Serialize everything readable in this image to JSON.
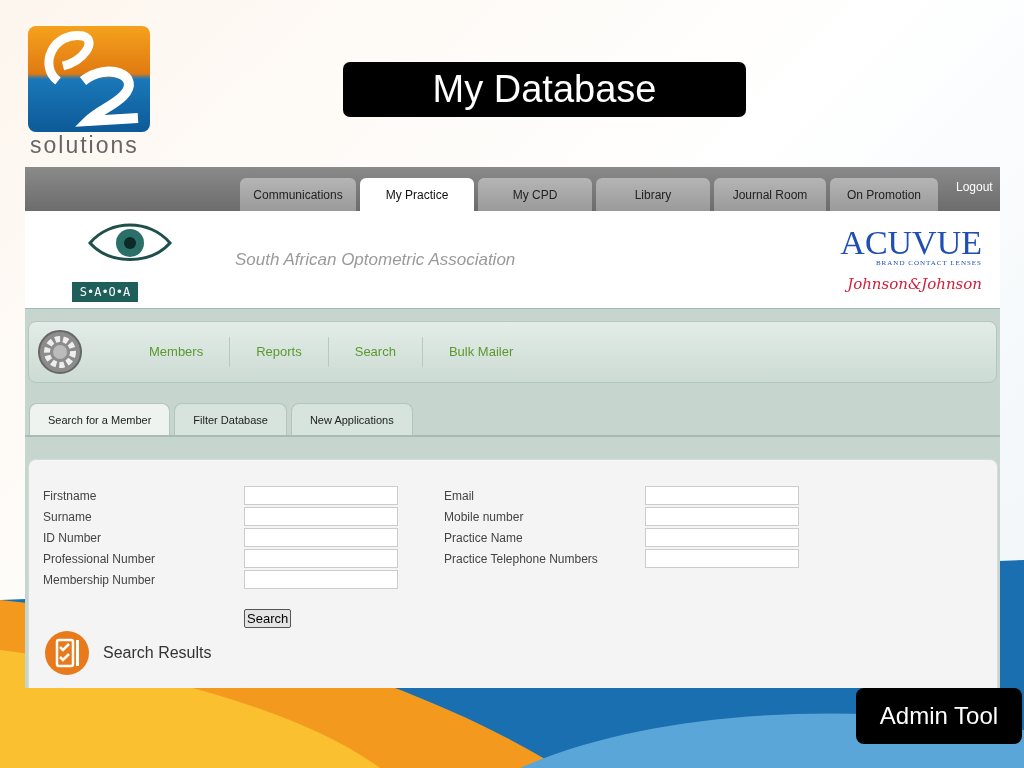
{
  "slide_title": "My Database",
  "logo": {
    "text": "solutions"
  },
  "nav_tabs": [
    {
      "label": "Communications",
      "selected": false
    },
    {
      "label": "My Practice",
      "selected": true
    },
    {
      "label": "My CPD",
      "selected": false
    },
    {
      "label": "Library",
      "selected": false
    },
    {
      "label": "Journal Room",
      "selected": false
    },
    {
      "label": "On Promotion",
      "selected": false
    }
  ],
  "logout": "Logout",
  "banner": {
    "org_badge": "S•A•O•A",
    "org_name": "South African Optometric Association",
    "sponsor": "ACUVUE",
    "sponsor_tagline": "BRAND CONTACT LENSES",
    "sponsor_parent": "Johnson&Johnson"
  },
  "menu": [
    "Members",
    "Reports",
    "Search",
    "Bulk Mailer"
  ],
  "sub_tabs": [
    {
      "label": "Search for a Member",
      "selected": true
    },
    {
      "label": "Filter Database",
      "selected": false
    },
    {
      "label": "New Applications",
      "selected": false
    }
  ],
  "form": {
    "left": [
      {
        "label": "Firstname"
      },
      {
        "label": "Surname"
      },
      {
        "label": "ID Number"
      },
      {
        "label": "Professional Number"
      },
      {
        "label": "Membership Number"
      }
    ],
    "right": [
      {
        "label": "Email"
      },
      {
        "label": "Mobile number"
      },
      {
        "label": "Practice Name"
      },
      {
        "label": "Practice Telephone Numbers"
      }
    ],
    "search_button": "Search"
  },
  "results_title": "Search Results",
  "footer_badge": "Admin Tool"
}
